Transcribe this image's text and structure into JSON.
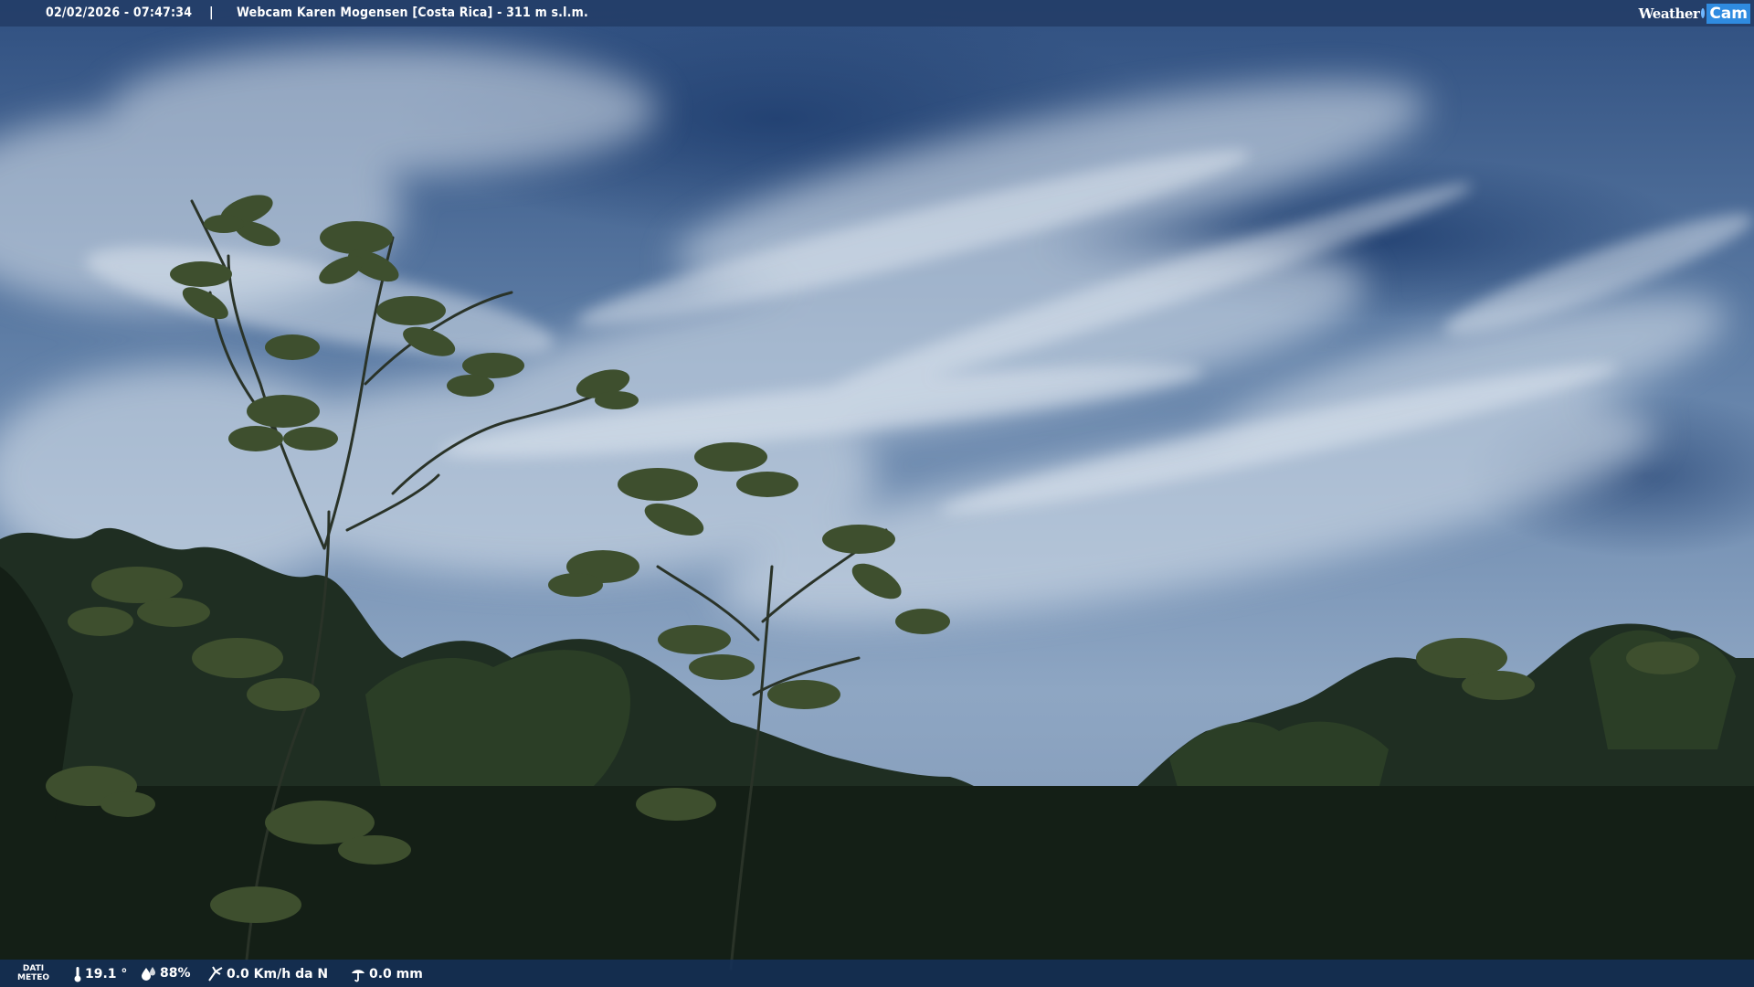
{
  "header": {
    "timestamp": "02/02/2026 - 07:47:34",
    "separator": "|",
    "title": "Webcam Karen Mogensen [Costa Rica] - 311 m s.l.m."
  },
  "logo": {
    "weather": "Weather",
    "cam": "Cam"
  },
  "footer": {
    "dati_line1": "DATI",
    "dati_line2": "METEO",
    "temperature": "19.1 °",
    "humidity": "88%",
    "wind": "0.0 Km/h da N",
    "rain": "0.0 mm"
  },
  "colors": {
    "sky_top": "#2d4f82",
    "sky_mid": "#8ea6c2",
    "vegetation": "#1d2b1e",
    "bar": "#243e68"
  },
  "icons": {
    "temperature": "thermometer-icon",
    "humidity": "droplet-icon",
    "wind": "wind-vane-icon",
    "rain": "rain-gauge-icon"
  }
}
